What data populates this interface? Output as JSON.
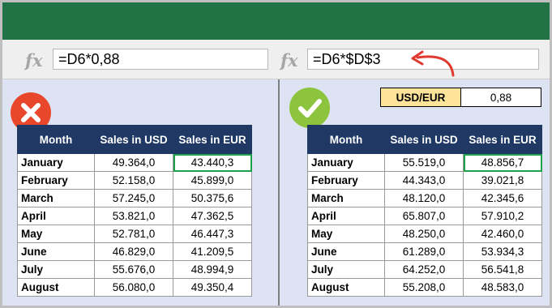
{
  "formula_bar": {
    "left": {
      "fx_icon": "function-icon",
      "formula": "=D6*0,88"
    },
    "right": {
      "fx_icon": "function-icon",
      "formula": "=D6*$D$3"
    }
  },
  "left_panel": {
    "badge": "wrong-x-icon",
    "badge_color": "#e8472b",
    "headers": [
      "Month",
      "Sales in USD",
      "Sales in EUR"
    ],
    "rows": [
      {
        "month": "January",
        "usd": "49.364,0",
        "eur": "43.440,3"
      },
      {
        "month": "February",
        "usd": "52.158,0",
        "eur": "45.899,0"
      },
      {
        "month": "March",
        "usd": "57.245,0",
        "eur": "50.375,6"
      },
      {
        "month": "April",
        "usd": "53.821,0",
        "eur": "47.362,5"
      },
      {
        "month": "May",
        "usd": "52.781,0",
        "eur": "46.447,3"
      },
      {
        "month": "June",
        "usd": "46.829,0",
        "eur": "41.209,5"
      },
      {
        "month": "July",
        "usd": "55.676,0",
        "eur": "48.994,9"
      },
      {
        "month": "August",
        "usd": "56.080,0",
        "eur": "49.350,4"
      }
    ]
  },
  "right_panel": {
    "badge": "correct-check-icon",
    "badge_color": "#8cc43e",
    "rate_label": "USD/EUR",
    "rate_value": "0,88",
    "headers": [
      "Month",
      "Sales in USD",
      "Sales in EUR"
    ],
    "rows": [
      {
        "month": "January",
        "usd": "55.519,0",
        "eur": "48.856,7"
      },
      {
        "month": "February",
        "usd": "44.343,0",
        "eur": "39.021,8"
      },
      {
        "month": "March",
        "usd": "48.120,0",
        "eur": "42.345,6"
      },
      {
        "month": "April",
        "usd": "65.807,0",
        "eur": "57.910,2"
      },
      {
        "month": "May",
        "usd": "48.250,0",
        "eur": "42.460,0"
      },
      {
        "month": "June",
        "usd": "61.289,0",
        "eur": "53.934,3"
      },
      {
        "month": "July",
        "usd": "64.252,0",
        "eur": "56.541,8"
      },
      {
        "month": "August",
        "usd": "55.208,0",
        "eur": "48.583,0"
      }
    ]
  },
  "colors": {
    "ribbon": "#217346",
    "header": "#1f3864",
    "highlight": "#1fa04a",
    "arrow": "#e03a2f",
    "rate_label_bg": "#fde499"
  }
}
